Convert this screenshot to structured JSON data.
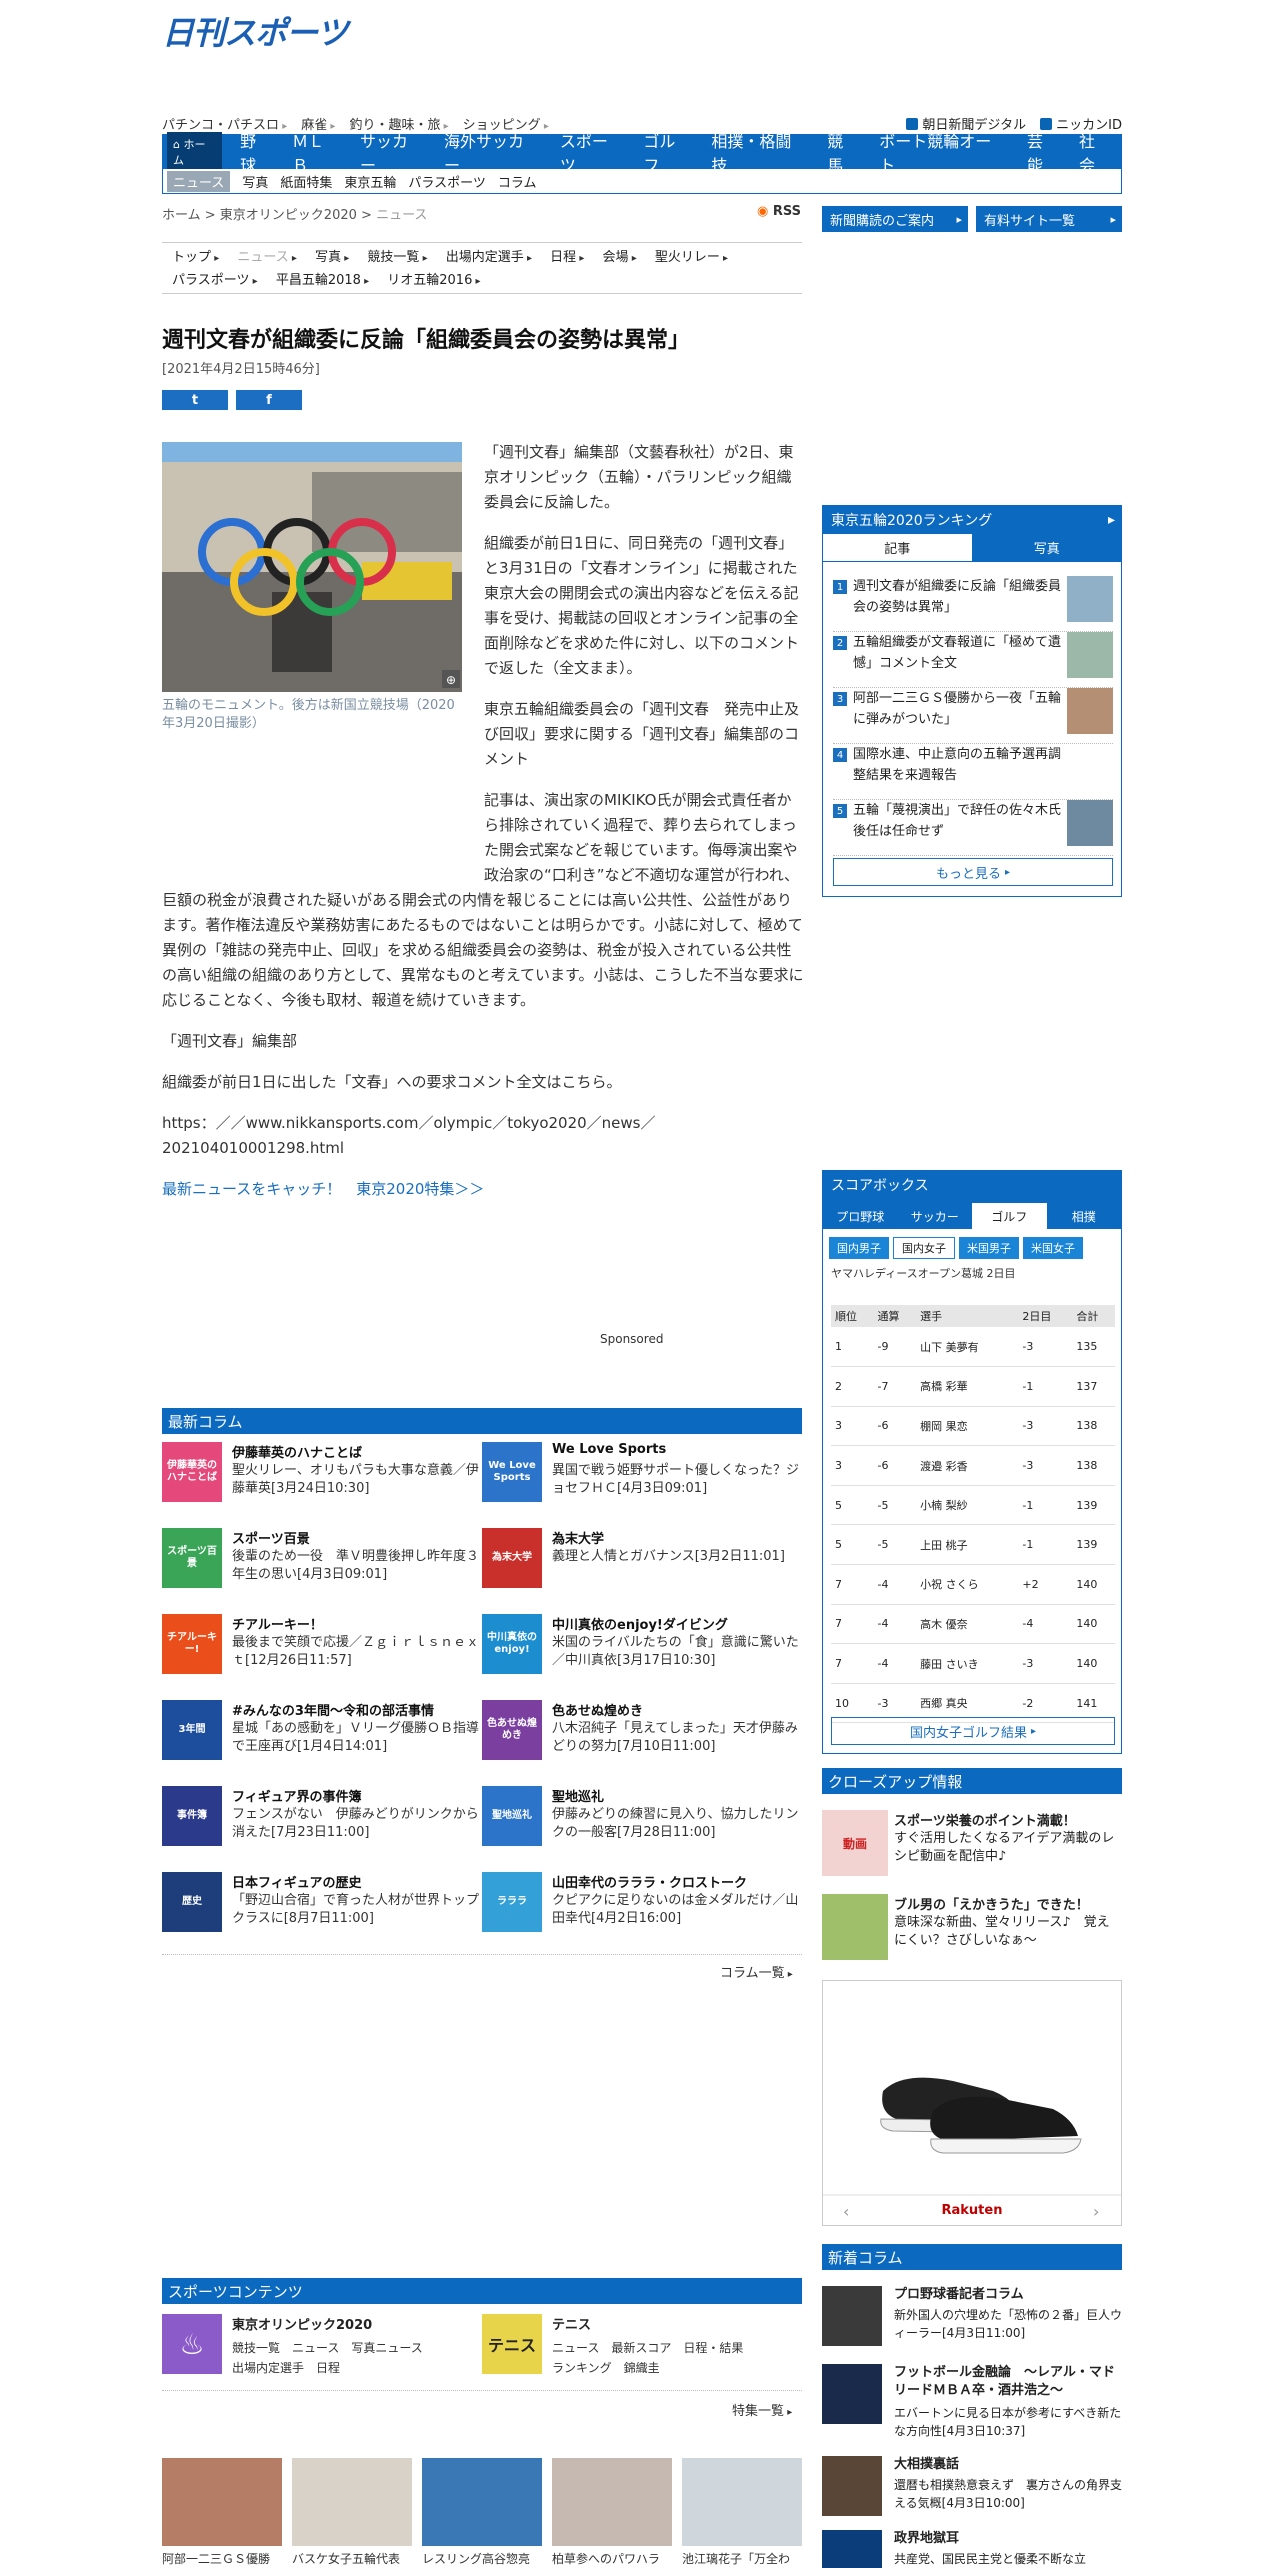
{
  "logo": "日刊スポーツ",
  "top_links": [
    "パチンコ・パチスロ",
    "麻雀",
    "釣り・趣味・旅",
    "ショッピング"
  ],
  "right_links": [
    "朝日新聞デジタル",
    "ニッカンID"
  ],
  "nav": {
    "home": "ホーム",
    "items": [
      "野球",
      "ＭＬＢ",
      "サッカー",
      "海外サッカー",
      "スポーツ",
      "ゴルフ",
      "相撲・格闘技",
      "競馬",
      "ボート競輪オート",
      "芸能",
      "社会"
    ],
    "sub": [
      "ニュース",
      "写真",
      "紙面特集",
      "東京五輪",
      "パラスポーツ",
      "コラム"
    ]
  },
  "breadcrumb": {
    "home": "ホーム",
    "section": "東京オリンピック2020",
    "current": "ニュース"
  },
  "rss": "RSS",
  "side_buttons": [
    "新聞購読のご案内",
    "有料サイト一覧"
  ],
  "subnav": {
    "row1": [
      "トップ",
      "ニュース",
      "写真",
      "競技一覧",
      "出場内定選手",
      "日程",
      "会場",
      "聖火リレー"
    ],
    "row2": [
      "パラスポーツ",
      "平昌五輪2018",
      "リオ五輪2016"
    ]
  },
  "article": {
    "title": "週刊文春が組織委に反論「組織委員会の姿勢は異常」",
    "date": "[2021年4月2日15時46分]",
    "photo_caption": "五輪のモニュメント。後方は新国立競技場（2020年3月20日撮影）",
    "paragraphs": [
      "「週刊文春」編集部（文藝春秋社）が2日、東京オリンピック（五輪）・パラリンピック組織委員会に反論した。",
      "組織委が前日1日に、同日発売の「週刊文春」と3月31日の「文春オンライン」に掲載された東京大会の開閉会式の演出内容などを伝える記事を受け、掲載誌の回収とオンライン記事の全面削除などを求めた件に対し、以下のコメントで返した（全文まま）。",
      "東京五輪組織委員会の「週刊文春　発売中止及び回収」要求に関する「週刊文春」編集部のコメント",
      "記事は、演出家のMIKIKO氏が開会式責任者から排除されていく過程で、葬り去られてしまった開会式案などを報じています。侮辱演出案や政治家の“口利き”など不適切な運営が行われ、巨額の税金が浪費された疑いがある開会式の内情を報じることには高い公共性、公益性があります。著作権法違反や業務妨害にあたるものではないことは明らかです。小誌に対して、極めて異例の「雑誌の発売中止、回収」を求める組織委員会の姿勢は、税金が投入されている公共性の高い組織の組織のあり方として、異常なものと考えています。小誌は、こうした不当な要求に応じることなく、今後も取材、報道を続けていきます。",
      "「週刊文春」編集部",
      "組織委が前日1日に出した「文春」への要求コメント全文はこちら。",
      "https：／／www.nikkansports.com／olympic／tokyo2020／news／202104010001298.html"
    ],
    "link": "最新ニュースをキャッチ！　東京2020特集＞＞",
    "share_twitter": "t",
    "share_facebook": "f"
  },
  "sponsored": "Sponsored",
  "latest_columns": {
    "heading": "最新コラム",
    "items": [
      {
        "title": "伊藤華英のハナことば",
        "desc": "聖火リレー、オリもパラも大事な意義／伊藤華英[3月24日10:30]",
        "color": "#e5487a",
        "thumb_text": "伊藤華英のハナことば"
      },
      {
        "title": "We Love Sports",
        "desc": "異国で戦う姫野サポート優しくなった？ジョセフＨＣ[4月3日09:01]",
        "color": "#2b74c9",
        "thumb_text": "We Love Sports"
      },
      {
        "title": "スポーツ百景",
        "desc": "後輩のため一役　準Ｖ明豊後押し昨年度３年生の思い[4月3日09:01]",
        "color": "#3aa457",
        "thumb_text": "スポーツ百景"
      },
      {
        "title": "為末大学",
        "desc": "義理と人情とガバナンス[3月2日11:01]",
        "color": "#c9302c",
        "thumb_text": "為末大学"
      },
      {
        "title": "チアルーキー！",
        "desc": "最後まで笑顔で応援／Ｚｇｉｒｌｓｎｅｘｔ[12月26日11:57]",
        "color": "#e94e1b",
        "thumb_text": "チアルーキー!"
      },
      {
        "title": "中川真依のenjoy!ダイビング",
        "desc": "米国のライバルたちの「食」意識に驚いた／中川真依[3月17日10:30]",
        "color": "#1c8ed0",
        "thumb_text": "中川真依のenjoy!"
      },
      {
        "title": "#みんなの3年間～令和の部活事情",
        "desc": "星城「あの感動を」Ｖリーグ優勝ＯＢ指導で王座再び[1月4日14:01]",
        "color": "#1d4e9e",
        "thumb_text": "3年間"
      },
      {
        "title": "色あせぬ煌めき",
        "desc": "八木沼純子「見えてしまった」天才伊藤みどりの努力[7月10日11:00]",
        "color": "#7b3fa0",
        "thumb_text": "色あせぬ煌めき"
      },
      {
        "title": "フィギュア界の事件簿",
        "desc": "フェンスがない　伊藤みどりがリンクから消えた[7月23日11:00]",
        "color": "#2c3a8c",
        "thumb_text": "事件簿"
      },
      {
        "title": "聖地巡礼",
        "desc": "伊藤みどりの練習に見入り、協力したリンクの一般客[7月28日11:00]",
        "color": "#2b74c9",
        "thumb_text": "聖地巡礼"
      },
      {
        "title": "日本フィギュアの歴史",
        "desc": "「野辺山合宿」で育った人材が世界トップクラスに[8月7日11:00]",
        "color": "#1d3e7a",
        "thumb_text": "歴史"
      },
      {
        "title": "山田幸代のラララ・クロストーク",
        "desc": "クピアクに足りないのは金メダルだけ／山田幸代[4月2日16:00]",
        "color": "#34a0d8",
        "thumb_text": "ラララ"
      }
    ],
    "more": "コラム一覧"
  },
  "sports_content": {
    "heading": "スポーツコンテンツ",
    "items": [
      {
        "title": "東京オリンピック2020",
        "links": "競技一覧　ニュース　写真ニュース",
        "links2": "出場内定選手　日程",
        "color": "#8b5cc9"
      },
      {
        "title": "テニス",
        "links": "ニュース　最新スコア　日程・結果",
        "links2": "ランキング　錦織圭",
        "color": "#e8d44a"
      }
    ],
    "more": "特集一覧"
  },
  "bottom_thumbs": [
    {
      "caption": "阿部一二三ＧＳ優勝",
      "color": "#b57c66"
    },
    {
      "caption": "バスケ女子五輪代表",
      "color": "#d8d2c8"
    },
    {
      "caption": "レスリング高谷惣亮",
      "color": "#3a78b5"
    },
    {
      "caption": "柏草参へのパワハラ",
      "color": "#c6b9b2"
    },
    {
      "caption": "池江璃花子「万全わ",
      "color": "#cfd6dc"
    }
  ],
  "ranking": {
    "heading": "東京五輪2020ランキング",
    "tabs": [
      "記事",
      "写真"
    ],
    "items": [
      {
        "num": "1",
        "text": "週刊文春が組織委に反論「組織委員会の姿勢は異常」"
      },
      {
        "num": "2",
        "text": "五輪組織委が文春報道に「極めて遺憾」コメント全文"
      },
      {
        "num": "3",
        "text": "阿部一二三ＧＳ優勝から一夜「五輪に弾みがついた」"
      },
      {
        "num": "4",
        "text": "国際水連、中止意向の五輪予選再調整結果を来週報告"
      },
      {
        "num": "5",
        "text": "五輪「蔑視演出」で辞任の佐々木氏後任は任命せず"
      }
    ],
    "more": "もっと見る"
  },
  "scorebox": {
    "heading": "スコアボックス",
    "tabs": [
      "プロ野球",
      "サッカー",
      "ゴルフ",
      "相撲"
    ],
    "subtabs": [
      "国内男子",
      "国内女子",
      "米国男子",
      "米国女子"
    ],
    "tournament": "ヤマハレディースオープン葛城 2日目",
    "columns": [
      "順位",
      "通算",
      "選手",
      "2日目",
      "合計"
    ],
    "rows": [
      [
        "1",
        "-9",
        "山下 美夢有",
        "-3",
        "135"
      ],
      [
        "2",
        "-7",
        "高橋 彩華",
        "-1",
        "137"
      ],
      [
        "3",
        "-6",
        "棚岡 果恋",
        "-3",
        "138"
      ],
      [
        "3",
        "-6",
        "渡邉 彩香",
        "-3",
        "138"
      ],
      [
        "5",
        "-5",
        "小楠 梨紗",
        "-1",
        "139"
      ],
      [
        "5",
        "-5",
        "上田 桃子",
        "-1",
        "139"
      ],
      [
        "7",
        "-4",
        "小祝 さくら",
        "+2",
        "140"
      ],
      [
        "7",
        "-4",
        "高木 優奈",
        "-4",
        "140"
      ],
      [
        "7",
        "-4",
        "藤田 さいき",
        "-3",
        "140"
      ],
      [
        "10",
        "-3",
        "西郷 真央",
        "-2",
        "141"
      ]
    ],
    "more": "国内女子ゴルフ結果"
  },
  "closeup": {
    "heading": "クローズアップ情報",
    "items": [
      {
        "title": "スポーツ栄養のポイント満載！",
        "desc": "すぐ活用したくなるアイデア満載のレシピ動画を配信中♪",
        "color": "#f3d2d2"
      },
      {
        "title": "ブル男の「えかきうた」できた！",
        "desc": "意味深な新曲、堂々リリース♪　覚えにくい？さびしいなぁ～",
        "color": "#9fbf6a"
      }
    ]
  },
  "ad": {
    "brand": "Rakuten"
  },
  "new_columns": {
    "heading": "新着コラム",
    "items": [
      {
        "title": "プロ野球番記者コラム",
        "desc": "新外国人の穴埋めた「恐怖の２番」巨人ウィーラー[4月3日11:00]",
        "color": "#3a3a3a"
      },
      {
        "title": "フットボール金融論　～レアル・マドリードＭＢＡ卒・酒井浩之～",
        "desc": "エバートンに見る日本が参考にすべき新たな方向性[4月3日10:37]",
        "color": "#1a2a4a"
      },
      {
        "title": "大相撲裏話",
        "desc": "還暦も相撲熱意衰えず　裏方さんの角界支える気概[4月3日10:00]",
        "color": "#5a4636"
      },
      {
        "title": "政界地獄耳",
        "desc": "共産党、国民民主党と優柔不断な立",
        "color": "#0b3d7a"
      }
    ]
  }
}
